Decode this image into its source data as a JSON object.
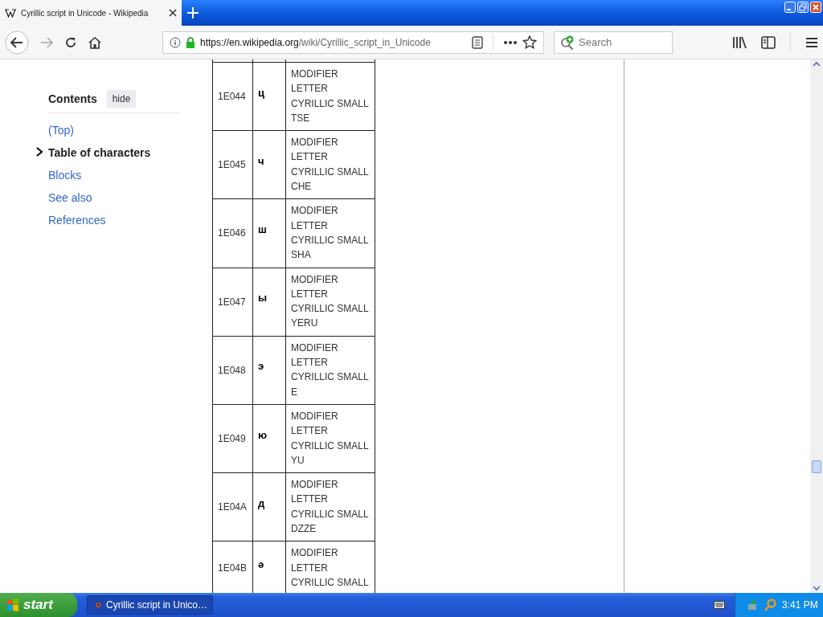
{
  "browser": {
    "tab": {
      "title": "Cyrillic script in Unicode - Wikipedia",
      "selected": true
    },
    "url": {
      "host": "https://en.wikipedia.org",
      "path": "/wiki/Cyrillic_script_in_Unicode"
    },
    "search": {
      "placeholder": "Search"
    }
  },
  "toc": {
    "title": "Contents",
    "toggle": "hide",
    "items": [
      {
        "label": "(Top)",
        "selected": false
      },
      {
        "label": "Table of characters",
        "selected": true
      },
      {
        "label": "Blocks",
        "selected": false
      },
      {
        "label": "See also",
        "selected": false
      },
      {
        "label": "References",
        "selected": false
      }
    ]
  },
  "table": {
    "rows": [
      {
        "code": "1E044",
        "glyph": "ц",
        "name": "MODIFIER LETTER CYRILLIC SMALL TSE"
      },
      {
        "code": "1E045",
        "glyph": "ч",
        "name": "MODIFIER LETTER CYRILLIC SMALL CHE"
      },
      {
        "code": "1E046",
        "glyph": "ш",
        "name": "MODIFIER LETTER CYRILLIC SMALL SHA"
      },
      {
        "code": "1E047",
        "glyph": "ы",
        "name": "MODIFIER LETTER CYRILLIC SMALL YERU"
      },
      {
        "code": "1E048",
        "glyph": "э",
        "name": "MODIFIER LETTER CYRILLIC SMALL E"
      },
      {
        "code": "1E049",
        "glyph": "ю",
        "name": "MODIFIER LETTER CYRILLIC SMALL YU"
      },
      {
        "code": "1E04A",
        "glyph": "д",
        "name": "MODIFIER LETTER CYRILLIC SMALL DZZE"
      },
      {
        "code": "1E04B",
        "glyph": "ә",
        "name": "MODIFIER LETTER CYRILLIC SMALL"
      }
    ]
  },
  "taskbar": {
    "start": "start",
    "task": "Cyrillic script in Unico…",
    "clock": "3:41 PM"
  }
}
